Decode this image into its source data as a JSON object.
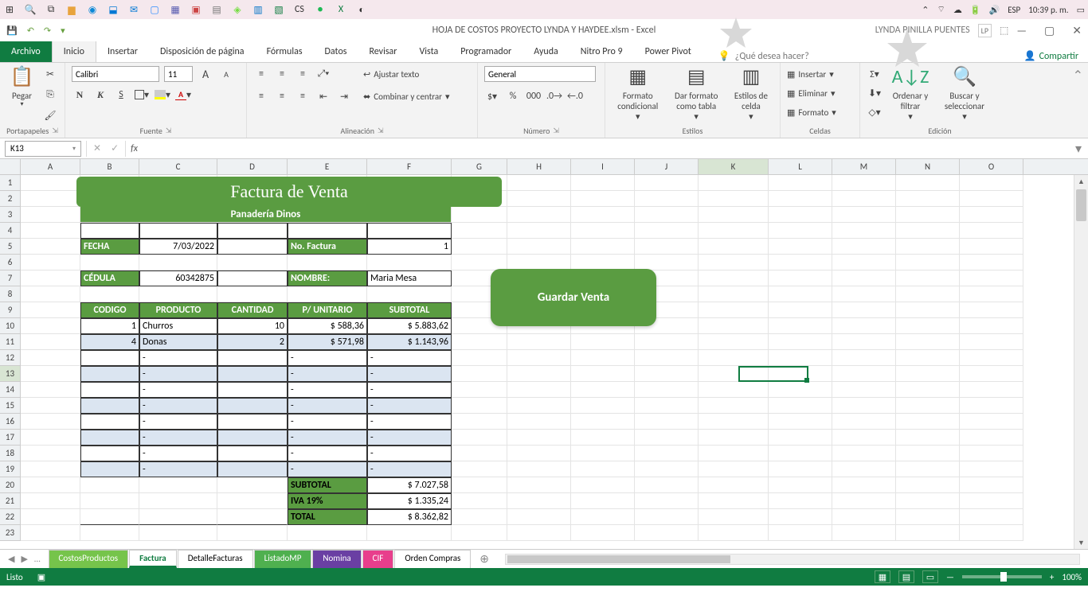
{
  "taskbar": {
    "right": {
      "lang": "ESP",
      "time": "10:39 p. m."
    }
  },
  "qat": {
    "title": "HOJA DE COSTOS PROYECTO  LYNDA Y HAYDEE.xlsm  -  Excel",
    "user": "LYNDA PINILLA PUENTES",
    "initials": "LP"
  },
  "ribbon": {
    "tabs": [
      "Archivo",
      "Inicio",
      "Insertar",
      "Disposición de página",
      "Fórmulas",
      "Datos",
      "Revisar",
      "Vista",
      "Programador",
      "Ayuda",
      "Nitro Pro 9",
      "Power Pivot"
    ],
    "tellme": "¿Qué desea hacer?",
    "share": "Compartir",
    "groups": {
      "clipboard": {
        "paste": "Pegar",
        "label": "Portapapeles"
      },
      "font": {
        "name": "Calibri",
        "size": "11",
        "label": "Fuente"
      },
      "align": {
        "wrap": "Ajustar texto",
        "merge": "Combinar y centrar",
        "label": "Alineación"
      },
      "number": {
        "format": "General",
        "label": "Número"
      },
      "styles": {
        "cond": "Formato condicional",
        "table": "Dar formato como tabla",
        "cell": "Estilos de celda",
        "label": "Estilos"
      },
      "cells": {
        "insert": "Insertar",
        "delete": "Eliminar",
        "format": "Formato",
        "label": "Celdas"
      },
      "editing": {
        "sort": "Ordenar y filtrar",
        "find": "Buscar y seleccionar",
        "label": "Edición"
      }
    }
  },
  "formula": {
    "namebox": "K13",
    "fx": "fx",
    "value": ""
  },
  "columns": [
    "A",
    "B",
    "C",
    "D",
    "E",
    "F",
    "G",
    "H",
    "I",
    "J",
    "K",
    "L",
    "M",
    "N",
    "O"
  ],
  "rows": [
    "1",
    "2",
    "3",
    "4",
    "5",
    "6",
    "7",
    "8",
    "9",
    "10",
    "11",
    "12",
    "13",
    "14",
    "15",
    "16",
    "17",
    "18",
    "19",
    "20",
    "21",
    "22",
    "23"
  ],
  "selection": {
    "row": 13,
    "col": "K"
  },
  "invoice": {
    "title": "Factura de Venta",
    "subtitle": "Panadería Dinos",
    "fecha_lbl": "FECHA",
    "fecha": "7/03/2022",
    "nofact_lbl": "No. Factura",
    "nofact": "1",
    "cedula_lbl": "CÉDULA",
    "cedula": "60342875",
    "nombre_lbl": "NOMBRE:",
    "nombre": "Maria Mesa",
    "cols": {
      "codigo": "CODIGO",
      "producto": "PRODUCTO",
      "cantidad": "CANTIDAD",
      "punit": "P/ UNITARIO",
      "subtotal": "SUBTOTAL"
    },
    "lines": [
      {
        "codigo": "1",
        "producto": "Churros",
        "cantidad": "10",
        "punit": "$ 588,36",
        "subtotal": "$ 5.883,62"
      },
      {
        "codigo": "4",
        "producto": "Donas",
        "cantidad": "2",
        "punit": "$ 571,98",
        "subtotal": "$ 1.143,96"
      }
    ],
    "empty_marker": "-",
    "summary": {
      "subtotal_lbl": "SUBTOTAL",
      "subtotal": "$ 7.027,58",
      "iva_lbl": "IVA 19%",
      "iva": "$ 1.335,24",
      "total_lbl": "TOTAL",
      "total": "$ 8.362,82"
    },
    "button": "Guardar Venta"
  },
  "sheets": {
    "tabs": [
      {
        "name": "CostosProductos",
        "color": "#76c44b"
      },
      {
        "name": "Factura",
        "color": "#107c41",
        "active": true
      },
      {
        "name": "DetalleFacturas",
        "color": ""
      },
      {
        "name": "ListadoMP",
        "color": "#4fb04f"
      },
      {
        "name": "Nomina",
        "color": "#6a3fa3"
      },
      {
        "name": "CIF",
        "color": "#e83e8c"
      },
      {
        "name": "Orden Compras",
        "color": ""
      }
    ]
  },
  "status": {
    "ready": "Listo",
    "zoom": "100%"
  }
}
